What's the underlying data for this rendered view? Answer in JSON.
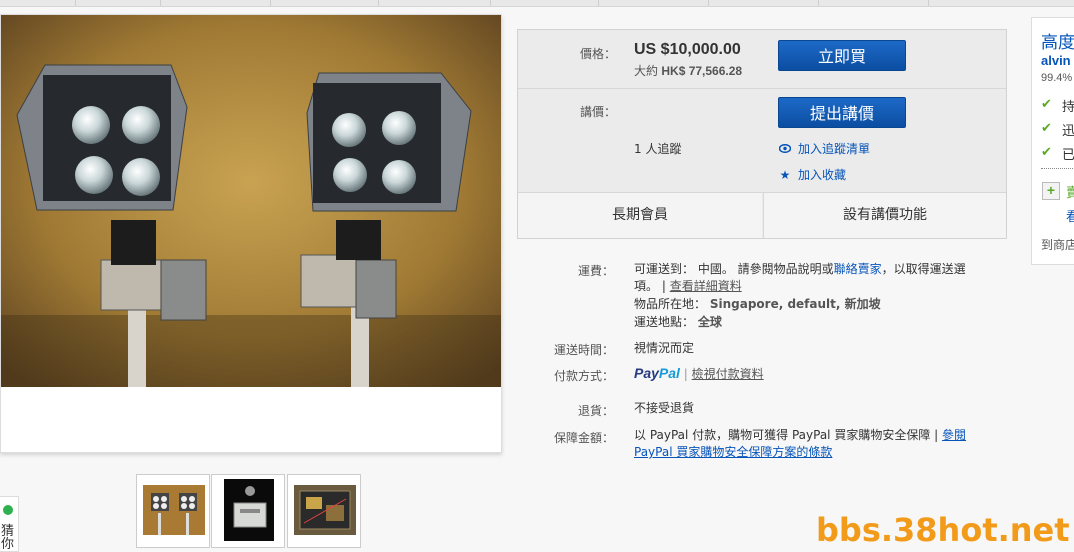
{
  "listing": {
    "price_label": "價格：",
    "price": "US $10,000.00",
    "approx_prefix": "大約",
    "approx_value": "HK$ 77,566.28",
    "buy_now_label": "立即買",
    "offer_label": "講價：",
    "make_offer_label": "提出講價",
    "watchers": "1 人追蹤",
    "add_watch_label": "加入追蹤清單",
    "add_collection_label": "加入收藏",
    "member_label": "長期會員",
    "best_offer_label": "設有講價功能"
  },
  "details": {
    "shipping_label": "運費：",
    "shipping_text_1": "可運送到： 中國。 請參閱物品說明或",
    "shipping_contact": "聯絡賣家",
    "shipping_text_2": "，以取得運送選",
    "shipping_text_3": "項。 |",
    "shipping_details_link": "查看詳細資料",
    "location_label": "物品所在地：",
    "location_value": "Singapore, default, 新加坡",
    "ship_to_label": "運送地點：",
    "ship_to_value": "全球",
    "delivery_label": "運送時間：",
    "delivery_value": "視情況而定",
    "payment_label": "付款方式：",
    "paypal_p1": "Pay",
    "paypal_p2": "Pal",
    "payment_sep": "|",
    "payment_link": "檢視付款資料",
    "returns_label": "退貨：",
    "returns_value": "不接受退貨",
    "guarantee_label": "保障金額：",
    "guarantee_text": "以 PayPal 付款，購物可獲得 PayPal 買家購物安全保障 |",
    "guarantee_link_1": "參閱",
    "guarantee_link_2": "PayPal 買家購物安全保障方案的條款"
  },
  "seller": {
    "title": "高度",
    "name": "alvin",
    "feedback_pct": "99.4%",
    "check_1": "持",
    "check_2": "迅",
    "check_3": "已",
    "save_label": "賣",
    "view_label": "看",
    "store_label": "到商店"
  },
  "side_widget": {
    "label": "猜你"
  },
  "watermark": "bbs.38hot.net",
  "colors": {
    "button_blue": "#0b4ea2",
    "link_blue": "#0654ba",
    "check_green": "#5ba829",
    "watermark_orange": "#f29b1a"
  }
}
